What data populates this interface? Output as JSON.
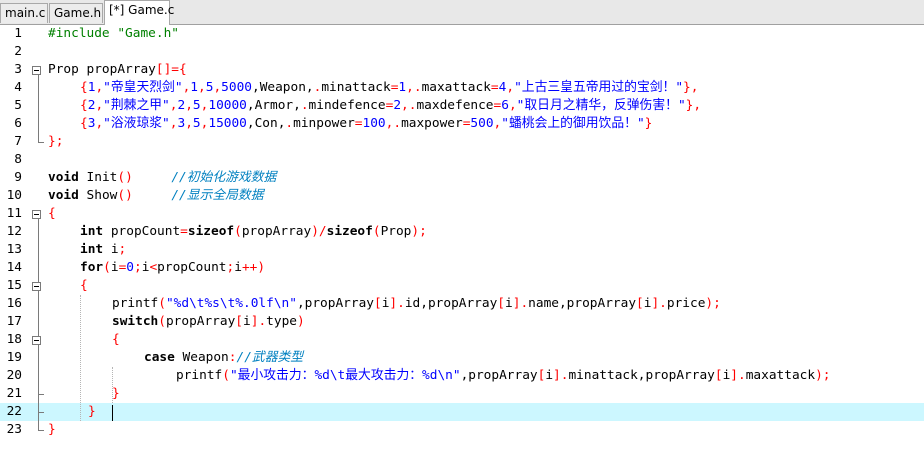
{
  "tabs": [
    {
      "label": "main.c",
      "active": false
    },
    {
      "label": "Game.h",
      "active": false
    },
    {
      "label": "[*] Game.c",
      "active": true
    }
  ],
  "line_numbers": [
    "1",
    "2",
    "3",
    "4",
    "5",
    "6",
    "7",
    "8",
    "9",
    "10",
    "11",
    "12",
    "13",
    "14",
    "15",
    "16",
    "17",
    "18",
    "19",
    "20",
    "21",
    "22",
    "23"
  ],
  "current_line": 22,
  "colors": {
    "keyword": "#000000",
    "string": "#0000ff",
    "number": "#0000ff",
    "operator": "#ff0000",
    "comment": "#0080c0",
    "preprocessor": "#008000",
    "current_line_bg": "#ccf7ff"
  },
  "code": {
    "l1": {
      "a": "#include \"Game.h\""
    },
    "l3": {
      "a": "Prop propArray",
      "b": "[]={"
    },
    "l4": {
      "a": "{",
      "b": "1",
      "c": ",",
      "d": "\"帝皇天烈剑\"",
      "e": ",",
      "f": "1",
      "g": ",",
      "h": "5",
      "i": ",",
      "j": "5000",
      "k": ",Weapon,",
      "l": ".",
      "m": "minattack",
      "n": "=",
      "o": "1",
      "p": ",",
      "q": ".",
      "r": "maxattack",
      "s": "=",
      "t": "4",
      "u": ",",
      "v": "\"上古三皇五帝用过的宝剑！\"",
      "w": "},"
    },
    "l5": {
      "a": "{",
      "b": "2",
      "c": ",",
      "d": "\"荆棘之甲\"",
      "e": ",",
      "f": "2",
      "g": ",",
      "h": "5",
      "i": ",",
      "j": "10000",
      "k": ",Armor,",
      "l": ".",
      "m": "mindefence",
      "n": "=",
      "o": "2",
      "p": ",",
      "q": ".",
      "r": "maxdefence",
      "s": "=",
      "t": "6",
      "u": ",",
      "v": "\"取日月之精华，反弹伤害！\"",
      "w": "},"
    },
    "l6": {
      "a": "{",
      "b": "3",
      "c": ",",
      "d": "\"浴液琼浆\"",
      "e": ",",
      "f": "3",
      "g": ",",
      "h": "5",
      "i": ",",
      "j": "15000",
      "k": ",Con,",
      "l": ".",
      "m": "minpower",
      "n": "=",
      "o": "100",
      "p": ",",
      "q": ".",
      "r": "maxpower",
      "s": "=",
      "t": "500",
      "u": ",",
      "v": "\"蟠桃会上的御用饮品！\"",
      "w": "}"
    },
    "l7": {
      "a": "};"
    },
    "l9": {
      "kw": "void",
      "a": " Init",
      "b": "()",
      "sp": "     ",
      "c": "//初始化游戏数据"
    },
    "l10": {
      "kw": "void",
      "a": " Show",
      "b": "()",
      "sp": "     ",
      "c": "//显示全局数据"
    },
    "l11": {
      "a": "{"
    },
    "l12": {
      "kw": "int",
      "a": " propCount",
      "b": "=",
      "kw2": "sizeof",
      "c": "(",
      "d": "propArray",
      "e": ")/",
      "kw3": "sizeof",
      "f": "(",
      "g": "Prop",
      "h": ");"
    },
    "l13": {
      "kw": "int",
      "a": " i",
      "b": ";"
    },
    "l14": {
      "kw": "for",
      "a": "(",
      "b": "i",
      "c": "=",
      "d": "0",
      "e": ";",
      "f": "i",
      "g": "<",
      "h": "propCount",
      "i": ";",
      "j": "i",
      "k": "++",
      "l": ")"
    },
    "l15": {
      "a": "{"
    },
    "l16": {
      "a": "printf",
      "b": "(",
      "c": "\"%d\\t%s\\t%.0lf\\n\"",
      "d": ",propArray",
      "e": "[",
      "f": "i",
      "g": "].",
      "h": "id,propArray",
      "i": "[",
      "j": "i",
      "k": "].",
      "l": "name,propArray",
      "m": "[",
      "n": "i",
      "o": "].",
      "p": "price",
      "q": ");"
    },
    "l17": {
      "kw": "switch",
      "a": "(",
      "b": "propArray",
      "c": "[",
      "d": "i",
      "e": "].",
      "f": "type",
      "g": ")"
    },
    "l18": {
      "a": "{"
    },
    "l19": {
      "kw": "case",
      "a": " Weapon",
      "b": ":",
      "c": "//武器类型"
    },
    "l20": {
      "a": "printf",
      "b": "(",
      "c": "\"最小攻击力：%d\\t最大攻击力：%d\\n\"",
      "d": ",propArray",
      "e": "[",
      "f": "i",
      "g": "].",
      "h": "minattack,propArray",
      "i": "[",
      "j": "i",
      "k": "].",
      "l": "maxattack",
      "m": ");"
    },
    "l21": {
      "a": "}"
    },
    "l22": {
      "a": "}"
    },
    "l23": {
      "a": "}"
    }
  }
}
